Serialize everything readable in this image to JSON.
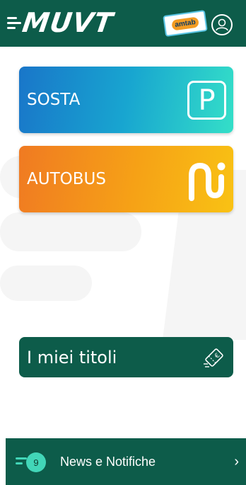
{
  "header": {
    "logo_text": "MUVT",
    "amtab_logo_text": "amtab",
    "profile_icon": "user-icon",
    "background_color": "#0d5c4a"
  },
  "cards": {
    "sosta": {
      "label": "SOSTA",
      "icon": "parking-icon"
    },
    "autobus": {
      "label": "AUTOBUS",
      "icon": "bus-route-icon"
    }
  },
  "titoli": {
    "label": "I miei titoli",
    "icon": "ticket-icon"
  },
  "footer": {
    "badge_count": "9",
    "label": "News e Notifiche",
    "chevron": "›"
  },
  "colors": {
    "primary_green": "#0d5c4a",
    "accent_teal": "#42d6b8",
    "sosta_gradient_start": "#1976c9",
    "sosta_gradient_end": "#34dfc8",
    "autobus_gradient_start": "#f07a22",
    "autobus_gradient_end": "#f9c214"
  }
}
